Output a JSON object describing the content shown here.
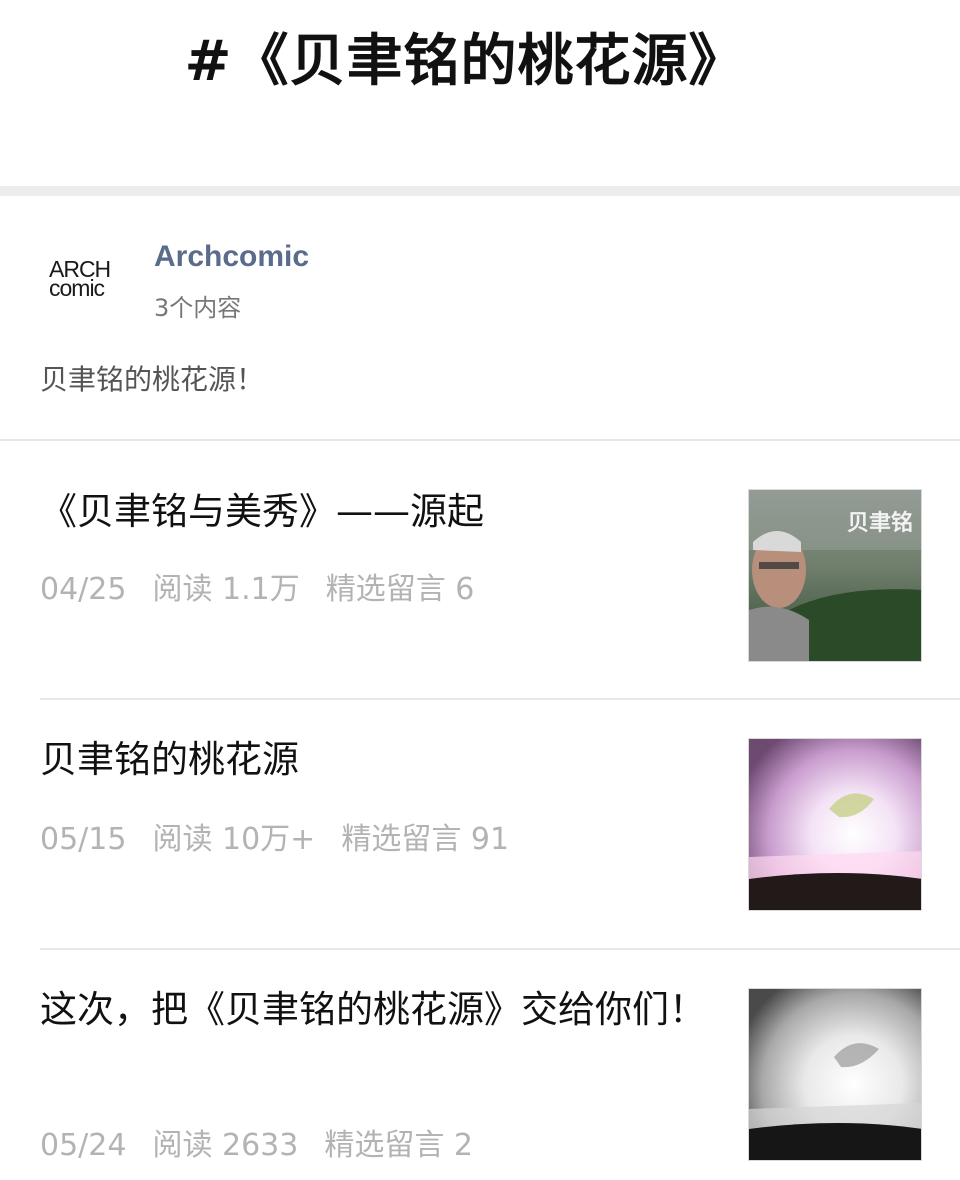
{
  "topic": {
    "title": "#《贝聿铭的桃花源》"
  },
  "account": {
    "avatar_line1": "ARCH",
    "avatar_line2": "comic",
    "name": "Archcomic",
    "count": "3个内容",
    "description": "贝聿铭的桃花源！"
  },
  "articles": [
    {
      "title": "《贝聿铭与美秀》——源起",
      "date": "04/25",
      "reads": "阅读 1.1万",
      "comments": "精选留言 6",
      "thumb_text": "贝聿铭"
    },
    {
      "title": "贝聿铭的桃花源",
      "date": "05/15",
      "reads": "阅读 10万+",
      "comments": "精选留言 91"
    },
    {
      "title": "这次，把《贝聿铭的桃花源》交给你们！",
      "date": "05/24",
      "reads": "阅读 2633",
      "comments": "精选留言 2"
    }
  ],
  "colors": {
    "account_name": "#5b6b8c",
    "meta": "#b3b3b3",
    "divider": "#e7e7e7",
    "band": "#ececec"
  }
}
